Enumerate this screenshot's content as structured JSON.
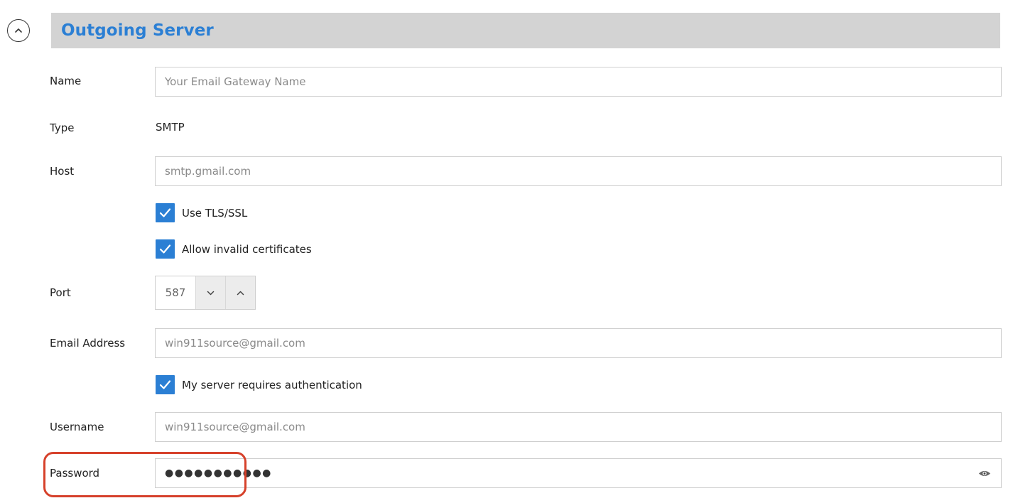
{
  "section": {
    "title": "Outgoing Server",
    "toggle_icon": "chevron-up-icon"
  },
  "fields": {
    "name": {
      "label": "Name",
      "value": "",
      "placeholder": "Your Email Gateway Name"
    },
    "type": {
      "label": "Type",
      "value": "SMTP"
    },
    "host": {
      "label": "Host",
      "value": "",
      "placeholder": "smtp.gmail.com"
    },
    "use_tls": {
      "label": "Use TLS/SSL",
      "checked": true
    },
    "allow_invalid_certs": {
      "label": "Allow invalid certificates",
      "checked": true
    },
    "port": {
      "label": "Port",
      "value": "587"
    },
    "email": {
      "label": "Email Address",
      "value": "",
      "placeholder": "win911source@gmail.com"
    },
    "requires_auth": {
      "label": "My server requires authentication",
      "checked": true
    },
    "username": {
      "label": "Username",
      "value": "",
      "placeholder": "win911source@gmail.com"
    },
    "password": {
      "label": "Password",
      "masked": "●●●●●●●●●●●",
      "reveal_icon": "eye-icon"
    }
  },
  "colors": {
    "accent": "#2b7fd4",
    "header_bg": "#d3d3d3",
    "highlight": "#d6412b"
  }
}
